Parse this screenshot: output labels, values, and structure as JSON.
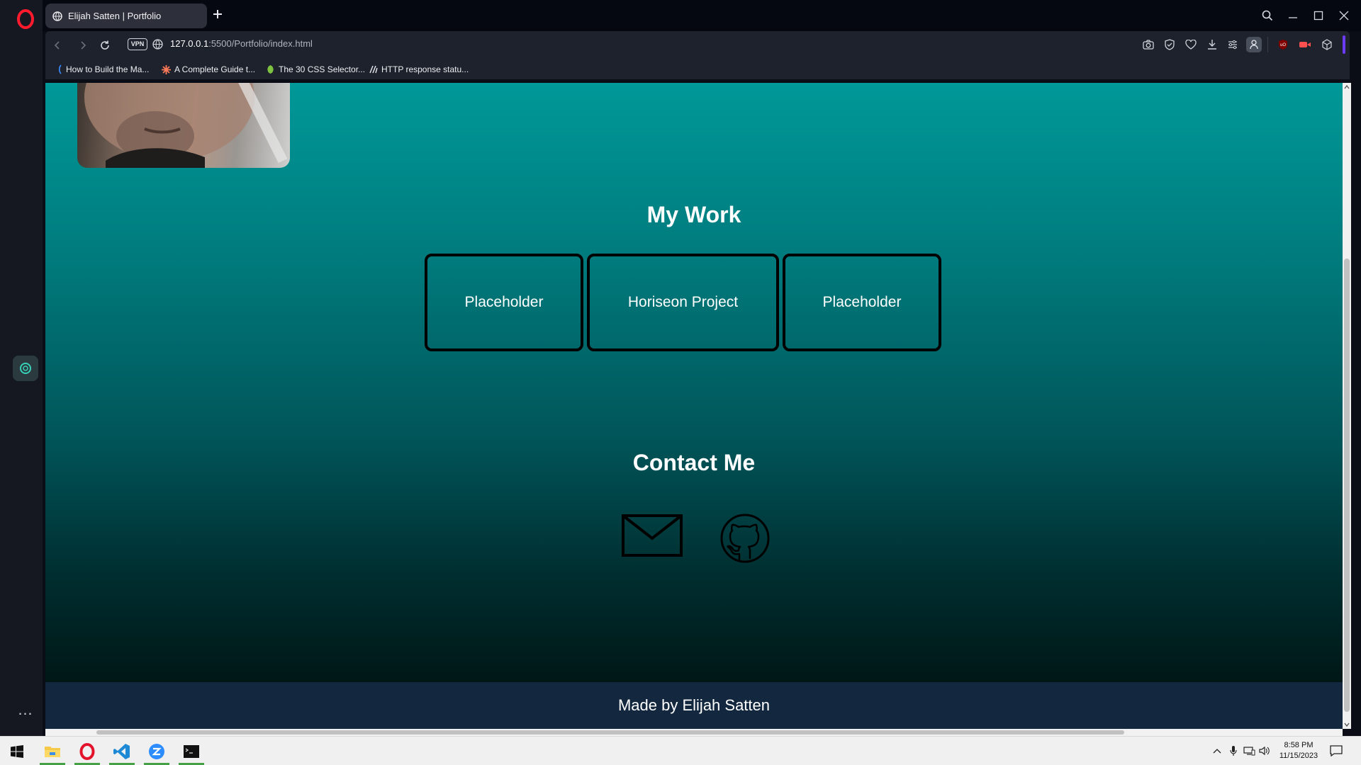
{
  "browser": {
    "tab_title": "Elijah Satten | Portfolio",
    "url_host": "127.0.0.1",
    "url_rest": ":5500/Portfolio/index.html",
    "vpn_label": "VPN",
    "sidebar_more": "…"
  },
  "bookmarks": [
    {
      "label": "How to Build the Ma...",
      "icon": "bookmark-freecodecamp-icon"
    },
    {
      "label": "A Complete Guide t...",
      "icon": "bookmark-csstricks-icon"
    },
    {
      "label": "The 30 CSS Selector...",
      "icon": "bookmark-tutsplus-icon"
    },
    {
      "label": "HTTP response statu...",
      "icon": "bookmark-mdn-icon"
    }
  ],
  "page": {
    "work_title": "My Work",
    "projects": [
      {
        "label": "Placeholder"
      },
      {
        "label": "Horiseon Project"
      },
      {
        "label": "Placeholder"
      }
    ],
    "contact_title": "Contact Me",
    "contact_icons": [
      "email-icon",
      "github-icon"
    ],
    "footer_text": "Made by Elijah Satten",
    "colors": {
      "gradient_top": "#009898",
      "gradient_bottom": "#001716",
      "footer_bg": "#13273f"
    }
  },
  "taskbar": {
    "time": "8:58 PM",
    "date": "11/15/2023",
    "apps": [
      "windows-start-icon",
      "file-explorer-icon",
      "opera-icon",
      "vscode-icon",
      "zoom-icon",
      "terminal-icon"
    ]
  }
}
